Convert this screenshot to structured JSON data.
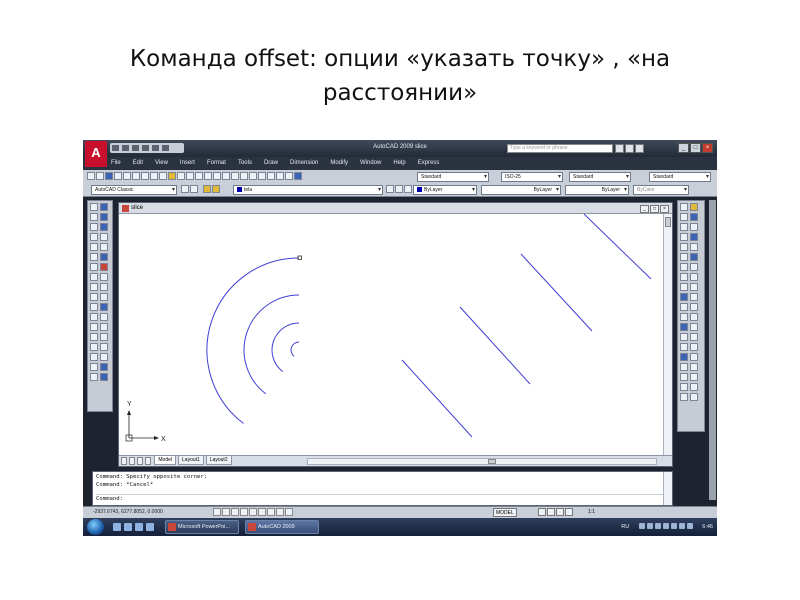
{
  "slide": {
    "title_line1": "Команда offset: опции «указать  точку» , «на",
    "title_line2": "расстоянии»"
  },
  "app": {
    "window_title": "AutoCAD 2009  slice",
    "logo_letter": "A",
    "search_placeholder": "Type a keyword or phrase",
    "menu": [
      "File",
      "Edit",
      "View",
      "Insert",
      "Format",
      "Tools",
      "Draw",
      "Dimension",
      "Modify",
      "Window",
      "Help",
      "Express"
    ],
    "toolbar": {
      "text_style": "Standard",
      "dim_style": "ISO-25",
      "table_style": "Standard",
      "multileader_style": "Standard",
      "workspace": "AutoCAD Classic",
      "layer": "tela",
      "color": "ByLayer",
      "linetype": "ByLayer",
      "lineweight": "ByLayer",
      "plot_style": "ByColor"
    },
    "drawing": {
      "tab_title": "slice",
      "axis_y": "Y",
      "axis_x": "X",
      "tabs": [
        "Model",
        "Layout1",
        "Layout2"
      ],
      "line_color": "#3f3fd6",
      "arc_count": 4,
      "line_count": 4
    },
    "command": {
      "line1": "Command: Specify opposite corner:",
      "line2": "Command: *Cancel*",
      "prompt": "Command:"
    },
    "status": {
      "coords": "-2937.6743, 6277.8052, 0.0000",
      "model": "MODEL",
      "scale": "1:1"
    },
    "taskbar": {
      "btn_powerpoint": "Microsoft PowerPoi...",
      "btn_autocad": "AutoCAD 2009",
      "lang": "RU",
      "clock": "6:46"
    }
  }
}
